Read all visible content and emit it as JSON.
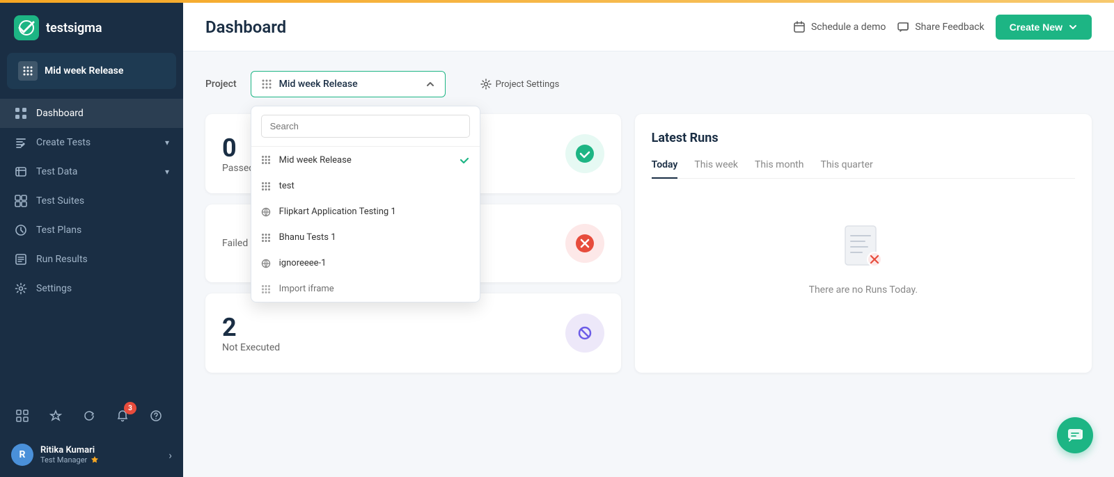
{
  "brand": {
    "name": "testsigma"
  },
  "sidebar": {
    "project_name": "Mid week Release",
    "nav_items": [
      {
        "id": "dashboard",
        "label": "Dashboard",
        "active": true,
        "has_arrow": false
      },
      {
        "id": "create-tests",
        "label": "Create Tests",
        "active": false,
        "has_arrow": true
      },
      {
        "id": "test-data",
        "label": "Test Data",
        "active": false,
        "has_arrow": true
      },
      {
        "id": "test-suites",
        "label": "Test Suites",
        "active": false,
        "has_arrow": false
      },
      {
        "id": "test-plans",
        "label": "Test Plans",
        "active": false,
        "has_arrow": false
      },
      {
        "id": "run-results",
        "label": "Run Results",
        "active": false,
        "has_arrow": false
      },
      {
        "id": "settings",
        "label": "Settings",
        "active": false,
        "has_arrow": false
      }
    ],
    "tools": [
      {
        "id": "grid-tool",
        "icon": "⊞"
      },
      {
        "id": "star-tool",
        "icon": "☆"
      },
      {
        "id": "refresh-tool",
        "icon": "↻"
      },
      {
        "id": "notification-tool",
        "icon": "🔔",
        "badge": "3"
      },
      {
        "id": "help-tool",
        "icon": "?"
      }
    ],
    "user": {
      "name": "Ritika Kumari",
      "role": "Test Manager",
      "avatar_initial": "R"
    }
  },
  "header": {
    "title": "Dashboard",
    "schedule_demo_label": "Schedule a demo",
    "share_feedback_label": "Share Feedback",
    "create_new_label": "Create New"
  },
  "project_bar": {
    "label": "Project",
    "settings_label": "Project Settings",
    "current_project": "Mid week Release",
    "search_placeholder": "Search",
    "projects": [
      {
        "id": 1,
        "name": "Mid week Release",
        "type": "grid",
        "selected": true
      },
      {
        "id": 2,
        "name": "test",
        "type": "grid",
        "selected": false
      },
      {
        "id": 3,
        "name": "Flipkart Application Testing 1",
        "type": "globe",
        "selected": false
      },
      {
        "id": 4,
        "name": "Bhanu Tests 1",
        "type": "grid",
        "selected": false
      },
      {
        "id": 5,
        "name": "ignoreeee-1",
        "type": "globe",
        "selected": false
      },
      {
        "id": 6,
        "name": "Import iframe",
        "type": "grid",
        "selected": false,
        "partial": true
      }
    ]
  },
  "stats": [
    {
      "id": "passed",
      "value": "0",
      "label": "Passed",
      "icon_type": "check",
      "color": "green"
    },
    {
      "id": "failed",
      "label": "Failed",
      "icon_type": "x",
      "color": "red"
    },
    {
      "id": "not-executed",
      "value": "2",
      "label": "Not Executed",
      "icon_type": "ban",
      "color": "purple"
    }
  ],
  "latest_runs": {
    "title": "Latest Runs",
    "tabs": [
      {
        "id": "today",
        "label": "Today",
        "active": true
      },
      {
        "id": "this-week",
        "label": "This week",
        "active": false
      },
      {
        "id": "this-month",
        "label": "This month",
        "active": false
      },
      {
        "id": "this-quarter",
        "label": "This quarter",
        "active": false
      }
    ],
    "empty_message": "There are no Runs Today."
  }
}
